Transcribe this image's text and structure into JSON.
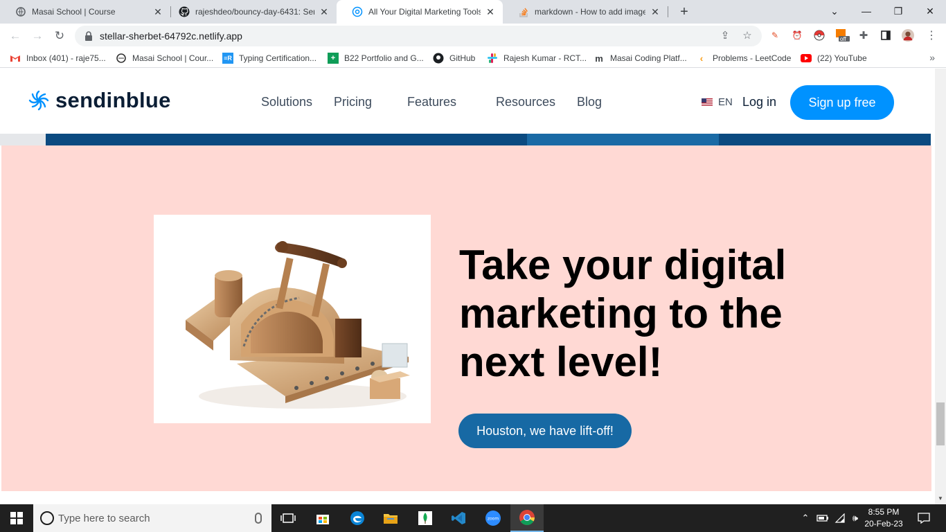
{
  "browser": {
    "tabs": [
      {
        "title": "Masai School | Course",
        "active": false
      },
      {
        "title": "rajeshdeo/bouncy-day-6431: Sen",
        "active": false
      },
      {
        "title": "All Your Digital Marketing Tools i",
        "active": true
      },
      {
        "title": "markdown - How to add images",
        "active": false
      }
    ],
    "address": "stellar-sherbet-64792c.netlify.app",
    "bookmarks": [
      "Inbox (401) - raje75...",
      "Masai School | Cour...",
      "Typing Certification...",
      "B22 Portfolio and G...",
      "GitHub",
      "Rajesh Kumar - RCT...",
      "Masai Coding Platf...",
      "Problems - LeetCode",
      "(22) YouTube"
    ],
    "ext_badge": "off"
  },
  "site": {
    "brand": "sendinblue",
    "nav": [
      "Solutions",
      "Pricing",
      "Features",
      "Resources",
      "Blog"
    ],
    "lang": "EN",
    "login": "Log in",
    "signup": "Sign up free",
    "brand_color": "#0092ff",
    "hero": {
      "title": "Take your digital marketing to the next level!",
      "cta": "Houston, we have lift-off!",
      "background": "#ffd9d4",
      "cta_color": "#1769a4"
    }
  },
  "taskbar": {
    "search_placeholder": "Type here to search",
    "time": "8:55 PM",
    "date": "20-Feb-23"
  }
}
